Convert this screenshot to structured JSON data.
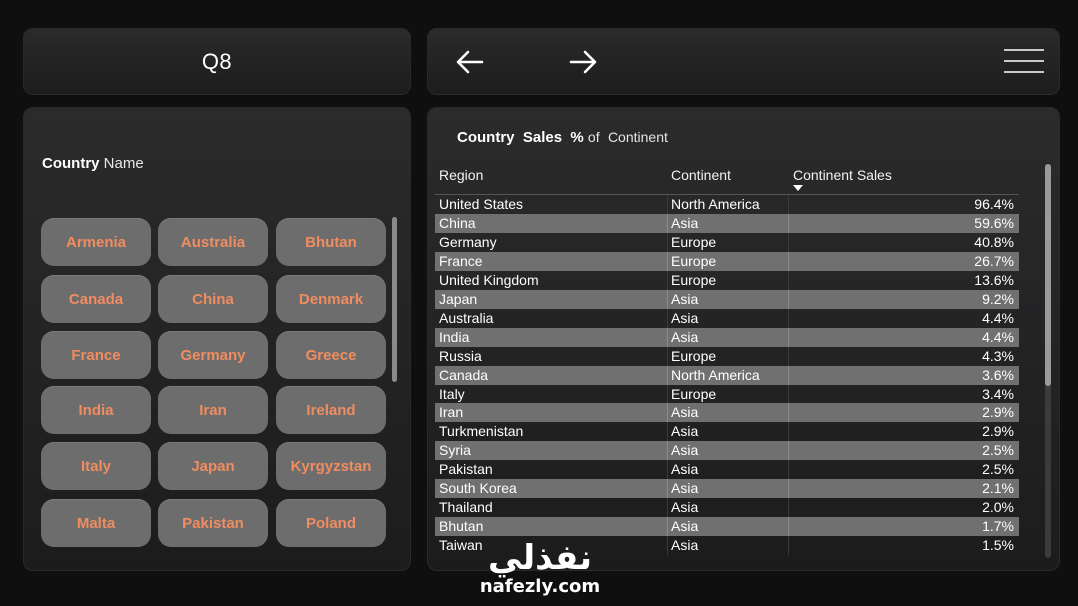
{
  "title": {
    "label": "Q8"
  },
  "nav": {
    "back_icon": "arrow-left-icon",
    "forward_icon": "arrow-right-icon",
    "menu_icon": "hamburger-menu-icon"
  },
  "slicer": {
    "header_bold": "Country",
    "header_light": "Name",
    "items": [
      "Armenia",
      "Australia",
      "Bhutan",
      "Canada",
      "China",
      "Denmark",
      "France",
      "Germany",
      "Greece",
      "India",
      "Iran",
      "Ireland",
      "Italy",
      "Japan",
      "Kyrgyzstan",
      "Malta",
      "Pakistan",
      "Poland"
    ]
  },
  "table": {
    "title_part1": "Country",
    "title_part2": "Sales",
    "title_part3": "%",
    "title_part4": "of",
    "title_part5": "Continent",
    "columns": [
      "Region",
      "Continent",
      "Continent Sales"
    ],
    "rows": [
      [
        "United States",
        "North America",
        "96.4%"
      ],
      [
        "China",
        "Asia",
        "59.6%"
      ],
      [
        "Germany",
        "Europe",
        "40.8%"
      ],
      [
        "France",
        "Europe",
        "26.7%"
      ],
      [
        "United Kingdom",
        "Europe",
        "13.6%"
      ],
      [
        "Japan",
        "Asia",
        "9.2%"
      ],
      [
        "Australia",
        "Asia",
        "4.4%"
      ],
      [
        "India",
        "Asia",
        "4.4%"
      ],
      [
        "Russia",
        "Europe",
        "4.3%"
      ],
      [
        "Canada",
        "North America",
        "3.6%"
      ],
      [
        "Italy",
        "Europe",
        "3.4%"
      ],
      [
        "Iran",
        "Asia",
        "2.9%"
      ],
      [
        "Turkmenistan",
        "Asia",
        "2.9%"
      ],
      [
        "Syria",
        "Asia",
        "2.5%"
      ],
      [
        "Pakistan",
        "Asia",
        "2.5%"
      ],
      [
        "South Korea",
        "Asia",
        "2.1%"
      ],
      [
        "Thailand",
        "Asia",
        "2.0%"
      ],
      [
        "Bhutan",
        "Asia",
        "1.7%"
      ],
      [
        "Taiwan",
        "Asia",
        "1.5%"
      ]
    ]
  },
  "watermark": {
    "arabic": "نفذلي",
    "latin": "nafezly.com"
  },
  "colors": {
    "chip_bg": "#6d6d6d",
    "chip_text": "#f08d60",
    "row_alt": "#707070"
  }
}
